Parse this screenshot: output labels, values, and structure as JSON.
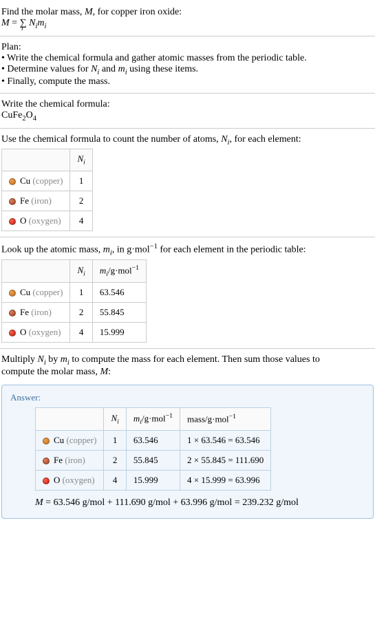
{
  "intro": {
    "line1_prefix": "Find the molar mass, ",
    "line1_var": "M",
    "line1_suffix": ", for copper iron oxide:",
    "formula_lhs": "M",
    "formula_eq": " = ",
    "formula_sum": "∑",
    "formula_sum_sub": "i",
    "formula_rhs1": " N",
    "formula_rhs1_sub": "i",
    "formula_rhs2": "m",
    "formula_rhs2_sub": "i"
  },
  "plan": {
    "title": "Plan:",
    "b1": "• Write the chemical formula and gather atomic masses from the periodic table.",
    "b2_pre": "• Determine values for ",
    "b2_n": "N",
    "b2_ni": "i",
    "b2_mid": " and ",
    "b2_m": "m",
    "b2_mi": "i",
    "b2_post": " using these items.",
    "b3": "• Finally, compute the mass."
  },
  "write_formula": {
    "title": "Write the chemical formula:",
    "f_cu": "CuFe",
    "f_2": "2",
    "f_o": "O",
    "f_4": "4"
  },
  "count": {
    "title_pre": "Use the chemical formula to count the number of atoms, ",
    "title_n": "N",
    "title_ni": "i",
    "title_post": ", for each element:",
    "col_n": "N",
    "col_ni": "i"
  },
  "elements": {
    "cu_sym": "Cu",
    "cu_name": " (copper)",
    "fe_sym": "Fe",
    "fe_name": " (iron)",
    "o_sym": "O",
    "o_name": " (oxygen)"
  },
  "counts": {
    "cu": "1",
    "fe": "2",
    "o": "4"
  },
  "lookup": {
    "title_pre": "Look up the atomic mass, ",
    "title_m": "m",
    "title_mi": "i",
    "title_mid": ", in g·mol",
    "title_exp": "−1",
    "title_post": " for each element in the periodic table:",
    "col_m": "m",
    "col_mi": "i",
    "col_unit": "/g·mol",
    "col_exp": "−1"
  },
  "masses": {
    "cu": "63.546",
    "fe": "55.845",
    "o": "15.999"
  },
  "multiply": {
    "l1_pre": "Multiply ",
    "l1_n": "N",
    "l1_ni": "i",
    "l1_mid": " by ",
    "l1_m": "m",
    "l1_mi": "i",
    "l1_post": " to compute the mass for each element. Then sum those values to",
    "l2_pre": "compute the molar mass, ",
    "l2_m": "M",
    "l2_post": ":"
  },
  "answer": {
    "label": "Answer:",
    "mass_col_pre": "mass/g·mol",
    "mass_col_exp": "−1",
    "cu_calc": "1 × 63.546 = 63.546",
    "fe_calc": "2 × 55.845 = 111.690",
    "o_calc": "4 × 15.999 = 63.996",
    "final_m": "M",
    "final_eq": " = 63.546 g/mol + 111.690 g/mol + 63.996 g/mol = 239.232 g/mol"
  }
}
